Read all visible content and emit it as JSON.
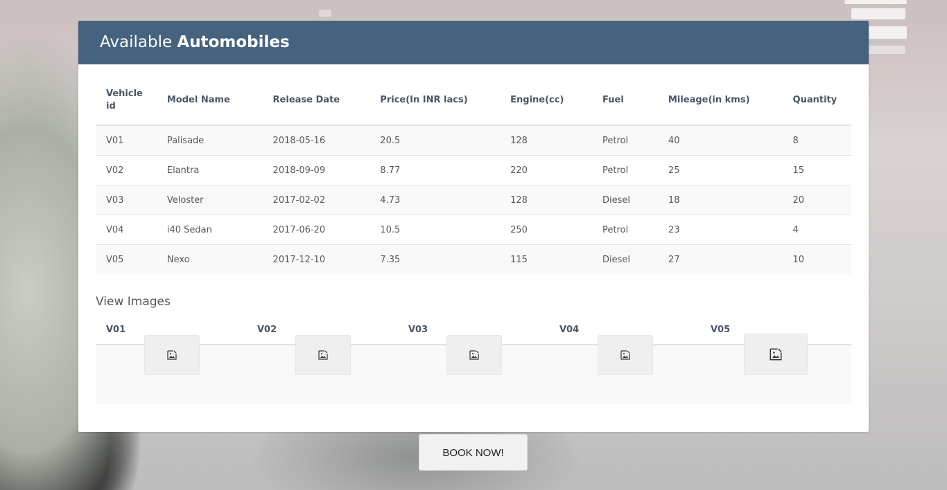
{
  "header": {
    "title_light": "Available",
    "title_bold": "Automobiles"
  },
  "table": {
    "columns": [
      "Vehicle id",
      "Model Name",
      "Release Date",
      "Price(In INR lacs)",
      "Engine(cc)",
      "Fuel",
      "Mileage(in kms)",
      "Quantity"
    ],
    "rows": [
      [
        "V01",
        "Palisade",
        "2018-05-16",
        "20.5",
        "128",
        "Petrol",
        "40",
        "8"
      ],
      [
        "V02",
        "Elantra",
        "2018-09-09",
        "8.77",
        "220",
        "Petrol",
        "25",
        "15"
      ],
      [
        "V03",
        "Veloster",
        "2017-02-02",
        "4.73",
        "128",
        "Diesel",
        "18",
        "20"
      ],
      [
        "V04",
        "i40 Sedan",
        "2017-06-20",
        "10.5",
        "250",
        "Petrol",
        "23",
        "4"
      ],
      [
        "V05",
        "Nexo",
        "2017-12-10",
        "7.35",
        "115",
        "Diesel",
        "27",
        "10"
      ]
    ]
  },
  "images": {
    "title": "View Images",
    "items": [
      {
        "label": "V01",
        "icon": "broken-image-icon"
      },
      {
        "label": "V02",
        "icon": "broken-image-icon"
      },
      {
        "label": "V03",
        "icon": "broken-image-icon"
      },
      {
        "label": "V04",
        "icon": "broken-image-icon"
      },
      {
        "label": "V05",
        "icon": "broken-image-icon"
      }
    ]
  },
  "actions": {
    "book_label": "BOOK NOW!"
  },
  "colors": {
    "header_bg": "#45627f",
    "header_text": "#ffffff",
    "table_text": "#55575c",
    "stripe_bg": "#f9f9f9"
  }
}
